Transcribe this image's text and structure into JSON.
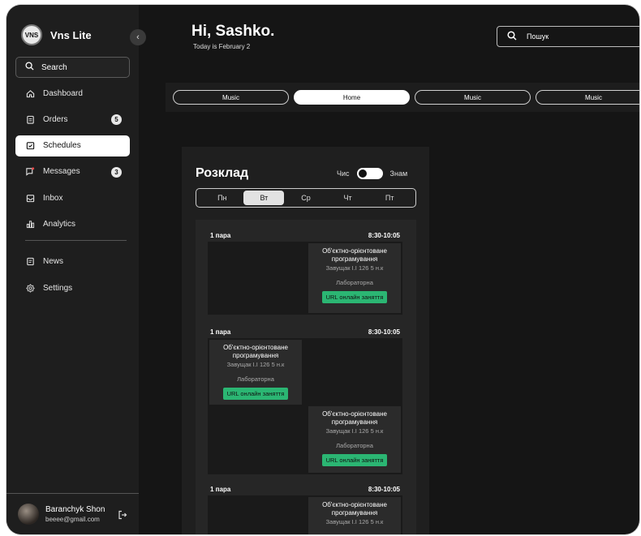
{
  "app": {
    "name": "Vns Lite",
    "logo_text": "VNS"
  },
  "sidebar": {
    "search_label": "Search",
    "items": [
      {
        "label": "Dashboard",
        "icon": "home-icon",
        "badge": null
      },
      {
        "label": "Orders",
        "icon": "clipboard-icon",
        "badge": "5"
      },
      {
        "label": "Schedules",
        "icon": "calendar-check-icon",
        "badge": null,
        "active": true
      },
      {
        "label": "Messages",
        "icon": "message-icon",
        "badge": "3"
      },
      {
        "label": "Inbox",
        "icon": "inbox-icon",
        "badge": null
      },
      {
        "label": "Analytics",
        "icon": "bar-chart-icon",
        "badge": null
      },
      {
        "label": "News",
        "icon": "news-icon",
        "badge": null
      },
      {
        "label": "Settings",
        "icon": "gear-icon",
        "badge": null
      }
    ],
    "profile": {
      "name": "Baranchyk Shon",
      "email": "beeee@gmail.com"
    }
  },
  "header": {
    "greeting": "Hi, Sashko.",
    "date": "Today is February 2",
    "search_placeholder": "Пошук"
  },
  "tabs": [
    {
      "label": "Music",
      "active": false
    },
    {
      "label": "Home",
      "active": true
    },
    {
      "label": "Music",
      "active": false
    },
    {
      "label": "Music",
      "active": false
    }
  ],
  "schedule": {
    "title": "Розклад",
    "toggle_left": "Чис",
    "toggle_right": "Знам",
    "days": [
      "Пн",
      "Вт",
      "Ср",
      "Чт",
      "Пт"
    ],
    "active_day": "Вт",
    "slots": [
      {
        "pair": "1 пара",
        "time": "8:30-10:05",
        "classes": [
          {
            "subject": "Об'єктно-орієнтоване програмування",
            "room": "Завущак І.І 126 5 н.к",
            "kind": "Лабораторна",
            "link": "URL онлайн заняття"
          }
        ]
      },
      {
        "pair": "1 пара",
        "time": "8:30-10:05",
        "classes": [
          {
            "subject": "Об'єктно-орієнтоване програмування",
            "room": "Завущак І.І 126 5 н.к",
            "kind": "Лабораторна",
            "link": "URL онлайн заняття"
          },
          {
            "subject": "Об'єктно-орієнтоване програмування",
            "room": "Завущак І.І 126 5 н.к",
            "kind": "Лабораторна",
            "link": "URL онлайн заняття"
          }
        ]
      },
      {
        "pair": "1 пара",
        "time": "8:30-10:05",
        "classes": [
          {
            "subject": "Об'єктно-орієнтоване програмування",
            "room": "Завущак І.І 126 5 н.к"
          }
        ]
      }
    ]
  },
  "colors": {
    "accent_green": "#2bb673",
    "background": "#151515",
    "sidebar": "#1e1e1e"
  }
}
